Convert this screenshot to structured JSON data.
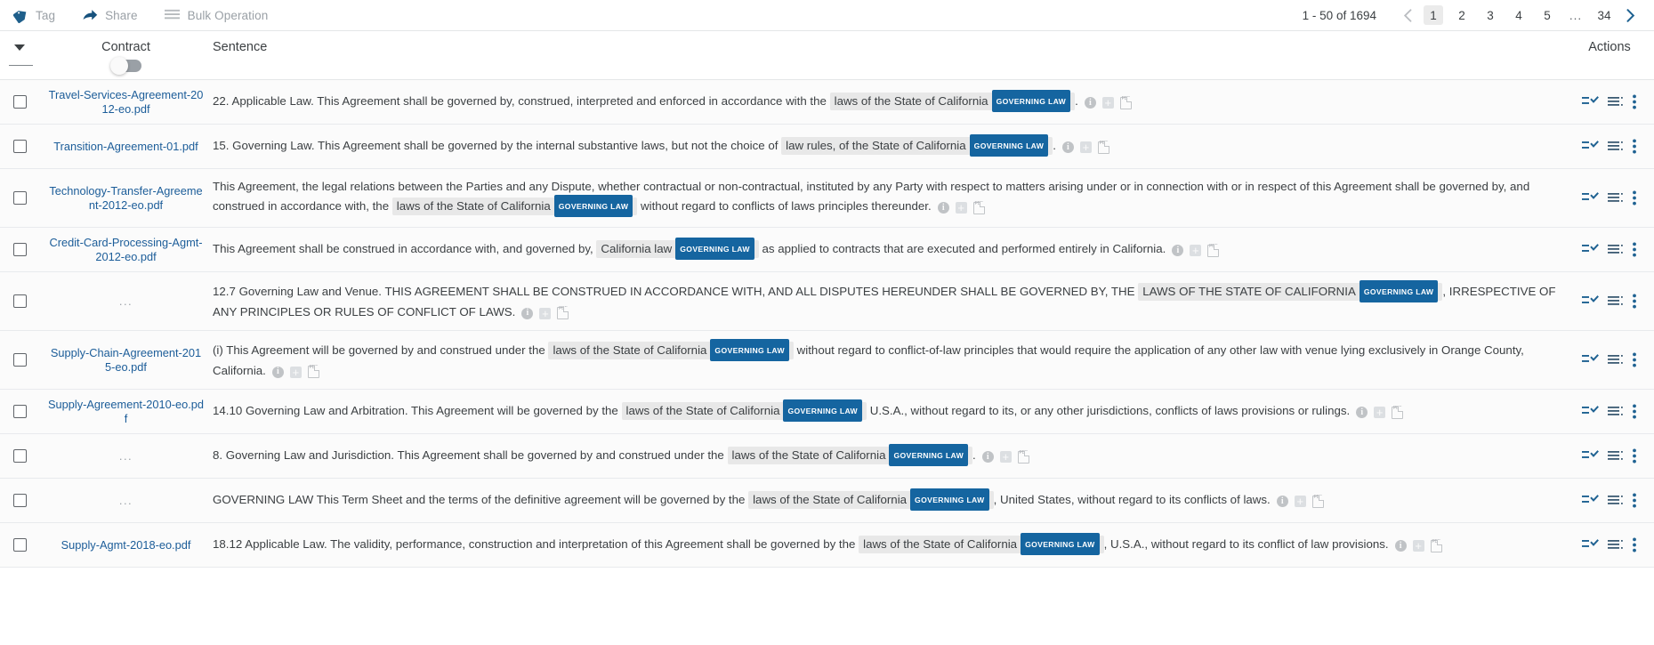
{
  "toolbar": {
    "items": [
      {
        "label": "Tag",
        "icon": "tag-icon"
      },
      {
        "label": "Share",
        "icon": "share-arrow-icon"
      },
      {
        "label": "Bulk Operation",
        "icon": "bulk-operation-icon"
      }
    ]
  },
  "pagination": {
    "range": "1 - 50 of 1694",
    "prev_icon": "chevron-left-icon",
    "next_icon": "chevron-right-icon",
    "pages": [
      "1",
      "2",
      "3",
      "4",
      "5",
      "...",
      "34"
    ],
    "current": "1"
  },
  "table": {
    "headers": {
      "sort_icon": "sort-caret-down-icon",
      "contract": "Contract",
      "sentence": "Sentence",
      "actions": "Actions"
    },
    "contract_toggle": {
      "name": "contract-name-toggle",
      "state": "off"
    },
    "row_icons": {
      "info": "i",
      "plus": "+",
      "pdf": "PDF"
    },
    "action_icons": [
      "task-list-check-icon",
      "list-lines-icon",
      "more-vertical-icon"
    ],
    "rows": [
      {
        "contract": "Travel-Services-Agreement-2012-eo.pdf",
        "contract_is_placeholder": false,
        "parts": [
          {
            "t": "text",
            "v": "22. Applicable Law. This Agreement shall be governed by, construed, interpreted and enforced in accordance with the "
          },
          {
            "t": "highlight",
            "v": "laws of the State of California",
            "badge": "GOVERNING LAW"
          },
          {
            "t": "text",
            "v": "."
          }
        ]
      },
      {
        "contract": "Transition-Agreement-01.pdf",
        "contract_is_placeholder": false,
        "parts": [
          {
            "t": "text",
            "v": "15. Governing Law. This Agreement shall be governed by the internal substantive laws, but not the choice of "
          },
          {
            "t": "highlight",
            "v": "law rules, of the State of California",
            "badge": "GOVERNING LAW"
          },
          {
            "t": "text",
            "v": "."
          }
        ]
      },
      {
        "contract": "Technology-Transfer-Agreement-2012-eo.pdf",
        "contract_is_placeholder": false,
        "parts": [
          {
            "t": "text",
            "v": "This Agreement, the legal relations between the Parties and any Dispute, whether contractual or non-contractual, instituted by any Party with respect to matters arising under or in connection with or in respect of this Agreement shall be governed by, and construed in accordance with, the "
          },
          {
            "t": "highlight",
            "v": "laws of the State of California",
            "badge": "GOVERNING LAW"
          },
          {
            "t": "text",
            "v": " without regard to conflicts of laws principles thereunder."
          }
        ]
      },
      {
        "contract": "Credit-Card-Processing-Agmt-2012-eo.pdf",
        "contract_is_placeholder": false,
        "parts": [
          {
            "t": "text",
            "v": " This Agreement shall be construed in accordance with, and governed by, "
          },
          {
            "t": "highlight",
            "v": "California law",
            "badge": "GOVERNING LAW"
          },
          {
            "t": "text",
            "v": " as applied to contracts that are executed and performed entirely in California."
          }
        ]
      },
      {
        "contract": "...",
        "contract_is_placeholder": true,
        "parts": [
          {
            "t": "text",
            "v": "12.7 Governing Law and Venue. THIS AGREEMENT SHALL BE CONSTRUED IN ACCORDANCE WITH, AND ALL DISPUTES HEREUNDER SHALL BE GOVERNED BY, THE "
          },
          {
            "t": "highlight",
            "v": "LAWS OF THE STATE OF CALIFORNIA",
            "badge": "GOVERNING LAW"
          },
          {
            "t": "text",
            "v": ", IRRESPECTIVE OF ANY PRINCIPLES OR RULES OF CONFLICT OF LAWS."
          }
        ]
      },
      {
        "contract": "Supply-Chain-Agreement-2015-eo.pdf",
        "contract_is_placeholder": false,
        "parts": [
          {
            "t": "text",
            "v": "(i) This Agreement will be governed by and construed under the "
          },
          {
            "t": "highlight",
            "v": "laws of the State of California",
            "badge": "GOVERNING LAW"
          },
          {
            "t": "text",
            "v": " without regard to conflict-of-law principles that would require the application of any other law with venue lying exclusively in Orange County, California."
          }
        ]
      },
      {
        "contract": "Supply-Agreement-2010-eo.pdf",
        "contract_is_placeholder": false,
        "parts": [
          {
            "t": "text",
            "v": "14.10 Governing Law and Arbitration. This Agreement will be governed by the "
          },
          {
            "t": "highlight",
            "v": "laws of the State of California",
            "badge": "GOVERNING LAW"
          },
          {
            "t": "text",
            "v": " U.S.A., without regard to its, or any other jurisdictions, conflicts of laws provisions or rulings."
          }
        ]
      },
      {
        "contract": "...",
        "contract_is_placeholder": true,
        "parts": [
          {
            "t": "text",
            "v": "8. Governing Law and Jurisdiction. This Agreement shall be governed by and construed under the "
          },
          {
            "t": "highlight",
            "v": "laws of the State of California",
            "badge": "GOVERNING LAW"
          },
          {
            "t": "text",
            "v": "."
          }
        ]
      },
      {
        "contract": "...",
        "contract_is_placeholder": true,
        "parts": [
          {
            "t": "text",
            "v": "GOVERNING LAW This Term Sheet and the terms of the definitive agreement will be governed by the "
          },
          {
            "t": "highlight",
            "v": "laws of the State of California",
            "badge": "GOVERNING LAW"
          },
          {
            "t": "text",
            "v": ", United States, without regard to its conflicts of laws."
          }
        ]
      },
      {
        "contract": "Supply-Agmt-2018-eo.pdf",
        "contract_is_placeholder": false,
        "parts": [
          {
            "t": "text",
            "v": "18.12 Applicable Law. The validity, performance, construction and interpretation of this Agreement shall be governed by the "
          },
          {
            "t": "highlight",
            "v": "laws of the State of California",
            "badge": "GOVERNING LAW"
          },
          {
            "t": "text",
            "v": ", U.S.A., without regard to its conflict of law provisions."
          }
        ]
      }
    ]
  },
  "colors": {
    "link": "#1c5d99",
    "badge": "#1565a0",
    "highlight": "#e8e8e8",
    "action_icon": "#1f6292"
  }
}
